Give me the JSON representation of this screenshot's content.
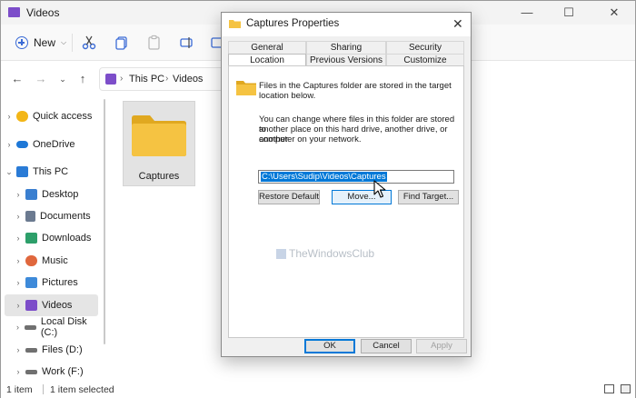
{
  "explorer": {
    "title": "Videos",
    "toolbar": {
      "new_label": "New"
    },
    "breadcrumb": [
      "This PC",
      "Videos"
    ],
    "sidebar": [
      {
        "label": "Quick access",
        "icon": "star-icon",
        "color": "#f3b617"
      },
      {
        "label": "OneDrive",
        "icon": "cloud-icon",
        "color": "#1e78d7"
      },
      {
        "label": "This PC",
        "icon": "monitor-icon",
        "color": "#2a7bd6"
      },
      {
        "label": "Desktop",
        "icon": "desktop-icon",
        "color": "#3a7fd0"
      },
      {
        "label": "Documents",
        "icon": "documents-icon",
        "color": "#6b7a90"
      },
      {
        "label": "Downloads",
        "icon": "download-icon",
        "color": "#2d9f6a"
      },
      {
        "label": "Music",
        "icon": "music-icon",
        "color": "#e0673d"
      },
      {
        "label": "Pictures",
        "icon": "pictures-icon",
        "color": "#3e8ad9"
      },
      {
        "label": "Videos",
        "icon": "videos-icon",
        "color": "#7c4dc9"
      },
      {
        "label": "Local Disk (C:)",
        "icon": "drive-icon",
        "color": "#707070"
      },
      {
        "label": "Files (D:)",
        "icon": "drive-icon",
        "color": "#707070"
      },
      {
        "label": "Work (F:)",
        "icon": "drive-icon",
        "color": "#707070"
      }
    ],
    "folder_name": "Captures",
    "status": {
      "count": "1 item",
      "selected": "1 item selected"
    }
  },
  "dialog": {
    "title": "Captures Properties",
    "tabs_row1": [
      "General",
      "Sharing",
      "Security"
    ],
    "tabs_row2": [
      "Location",
      "Previous Versions",
      "Customize"
    ],
    "info1": [
      "Files in the Captures folder are stored in the target",
      "location below."
    ],
    "info2": [
      "You can change where files in this folder are stored to",
      "another place on this hard drive, another drive, or another",
      "computer on your network."
    ],
    "path": "C:\\Users\\Sudip\\Videos\\Captures",
    "buttons": {
      "restore": "Restore Default",
      "move": "Move...",
      "find": "Find Target..."
    },
    "footer": {
      "ok": "OK",
      "cancel": "Cancel",
      "apply": "Apply"
    },
    "watermark": "TheWindowsClub"
  },
  "colors": {
    "accent": "#0078d7",
    "folder": "#f5c342"
  }
}
